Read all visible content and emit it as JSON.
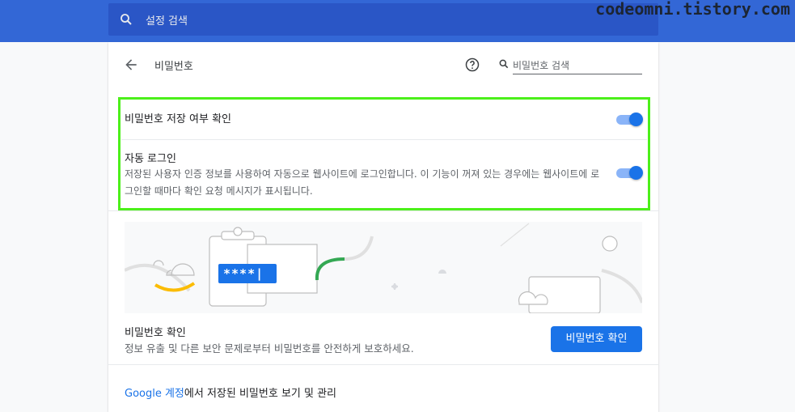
{
  "watermark": "codeomni.tistory.com",
  "search": {
    "placeholder": "설정 검색"
  },
  "page": {
    "title": "비밀번호",
    "search_placeholder": "비밀번호 검색"
  },
  "settings": {
    "offer_to_save": {
      "label": "비밀번호 저장 여부 확인",
      "enabled": true
    },
    "auto_signin": {
      "label": "자동 로그인",
      "description": "저장된 사용자 인증 정보를 사용하여 자동으로 웹사이트에 로그인합니다. 이 기능이 꺼져 있는 경우에는 웹사이트에 로그인할 때마다 확인 요청 메시지가 표시됩니다.",
      "enabled": true
    }
  },
  "illustration": {
    "password_mask": "****|"
  },
  "check": {
    "title": "비밀번호 확인",
    "description": "정보 유출 및 다른 보안 문제로부터 비밀번호를 안전하게 보호하세요.",
    "button_label": "비밀번호 확인"
  },
  "footer": {
    "link_text": "Google 계정",
    "rest_text": "에서 저장된 비밀번호 보기 및 관리"
  },
  "colors": {
    "header_blue": "#3367d6",
    "accent": "#1a73e8",
    "highlight_border": "#4cf01a"
  }
}
